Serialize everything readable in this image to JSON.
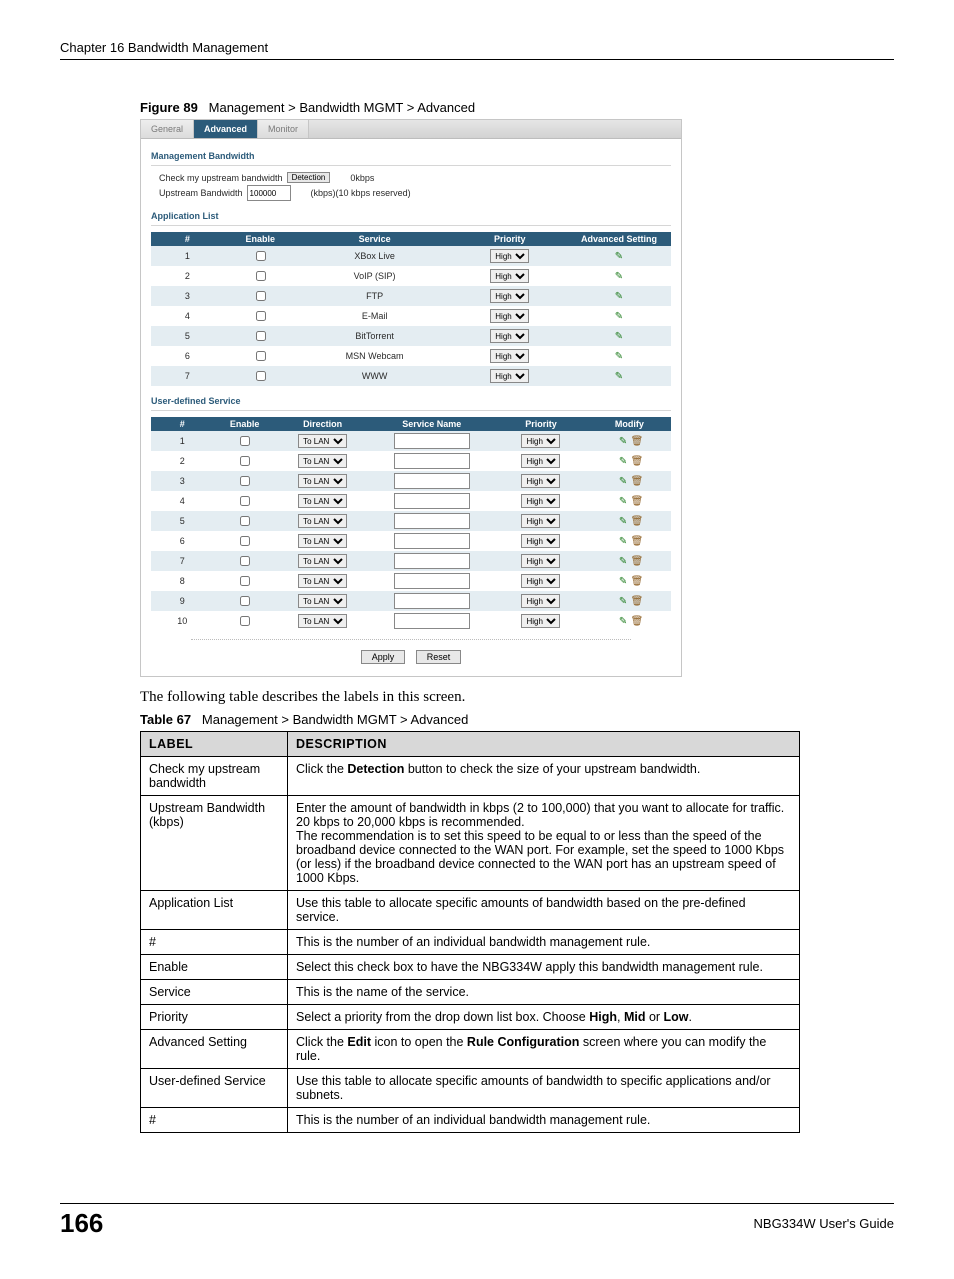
{
  "chapterHeader": "Chapter 16 Bandwidth Management",
  "figure": {
    "prefix": "Figure 89",
    "title": "Management > Bandwidth MGMT > Advanced"
  },
  "tabs": {
    "general": "General",
    "advanced": "Advanced",
    "monitor": "Monitor"
  },
  "panel": {
    "mgmtBandwidthTitle": "Management Bandwidth",
    "checkLabel": "Check my upstream bandwidth",
    "detectionBtn": "Detection",
    "detectedValue": "0kbps",
    "upstreamLabel": "Upstream Bandwidth",
    "upstreamValue": "100000",
    "upstreamNote": "(kbps)(10 kbps reserved)",
    "appListTitle": "Application List",
    "appHeaders": {
      "num": "#",
      "enable": "Enable",
      "service": "Service",
      "priority": "Priority",
      "advset": "Advanced Setting"
    },
    "appRows": [
      {
        "n": "1",
        "service": "XBox Live",
        "priority": "High"
      },
      {
        "n": "2",
        "service": "VoIP (SIP)",
        "priority": "High"
      },
      {
        "n": "3",
        "service": "FTP",
        "priority": "High"
      },
      {
        "n": "4",
        "service": "E-Mail",
        "priority": "High"
      },
      {
        "n": "5",
        "service": "BitTorrent",
        "priority": "High"
      },
      {
        "n": "6",
        "service": "MSN Webcam",
        "priority": "High"
      },
      {
        "n": "7",
        "service": "WWW",
        "priority": "High"
      }
    ],
    "userDefTitle": "User-defined Service",
    "userHeaders": {
      "num": "#",
      "enable": "Enable",
      "direction": "Direction",
      "servname": "Service Name",
      "priority": "Priority",
      "modify": "Modify"
    },
    "userRows": [
      {
        "n": "1",
        "dir": "To LAN",
        "priority": "High"
      },
      {
        "n": "2",
        "dir": "To LAN",
        "priority": "High"
      },
      {
        "n": "3",
        "dir": "To LAN",
        "priority": "High"
      },
      {
        "n": "4",
        "dir": "To LAN",
        "priority": "High"
      },
      {
        "n": "5",
        "dir": "To LAN",
        "priority": "High"
      },
      {
        "n": "6",
        "dir": "To LAN",
        "priority": "High"
      },
      {
        "n": "7",
        "dir": "To LAN",
        "priority": "High"
      },
      {
        "n": "8",
        "dir": "To LAN",
        "priority": "High"
      },
      {
        "n": "9",
        "dir": "To LAN",
        "priority": "High"
      },
      {
        "n": "10",
        "dir": "To LAN",
        "priority": "High"
      }
    ],
    "applyBtn": "Apply",
    "resetBtn": "Reset"
  },
  "afterFigureText": "The following table describes the labels in this screen.",
  "tableCaption": {
    "prefix": "Table 67",
    "title": "Management > Bandwidth MGMT > Advanced"
  },
  "descTable": {
    "headers": {
      "label": "LABEL",
      "desc": "DESCRIPTION"
    },
    "rows": [
      {
        "label": "Check my upstream bandwidth",
        "desc": "Click the <b>Detection</b> button to check the size of your upstream bandwidth."
      },
      {
        "label": "Upstream Bandwidth (kbps)",
        "desc": "Enter the amount of bandwidth in kbps (2 to 100,000) that you want to allocate for traffic. 20 kbps to 20,000 kbps is recommended.<br>The recommendation is to set this speed to be equal to or less than the speed of the broadband device connected to the WAN port. For example, set the speed to 1000 Kbps (or less) if the broadband device connected to the WAN port has an upstream speed of 1000 Kbps."
      },
      {
        "label": "Application List",
        "desc": "Use this table to allocate specific amounts of bandwidth based on the pre-defined service."
      },
      {
        "label": "#",
        "desc": "This is the number of an individual bandwidth management rule."
      },
      {
        "label": "Enable",
        "desc": "Select this check box to have the NBG334W apply this bandwidth management rule."
      },
      {
        "label": "Service",
        "desc": "This is the name of the service."
      },
      {
        "label": "Priority",
        "desc": "Select a priority from the drop down list box. Choose <b>High</b>, <b>Mid</b> or <b>Low</b>."
      },
      {
        "label": "Advanced Setting",
        "desc": "Click the <b>Edit</b> icon to open the <b>Rule Configuration</b> screen where you can modify the rule."
      },
      {
        "label": "User-defined Service",
        "desc": "Use this table to allocate specific amounts of bandwidth to specific applications and/or subnets."
      },
      {
        "label": "#",
        "desc": "This is the number of an individual bandwidth management rule."
      }
    ]
  },
  "footer": {
    "page": "166",
    "guide": "NBG334W User's Guide"
  }
}
